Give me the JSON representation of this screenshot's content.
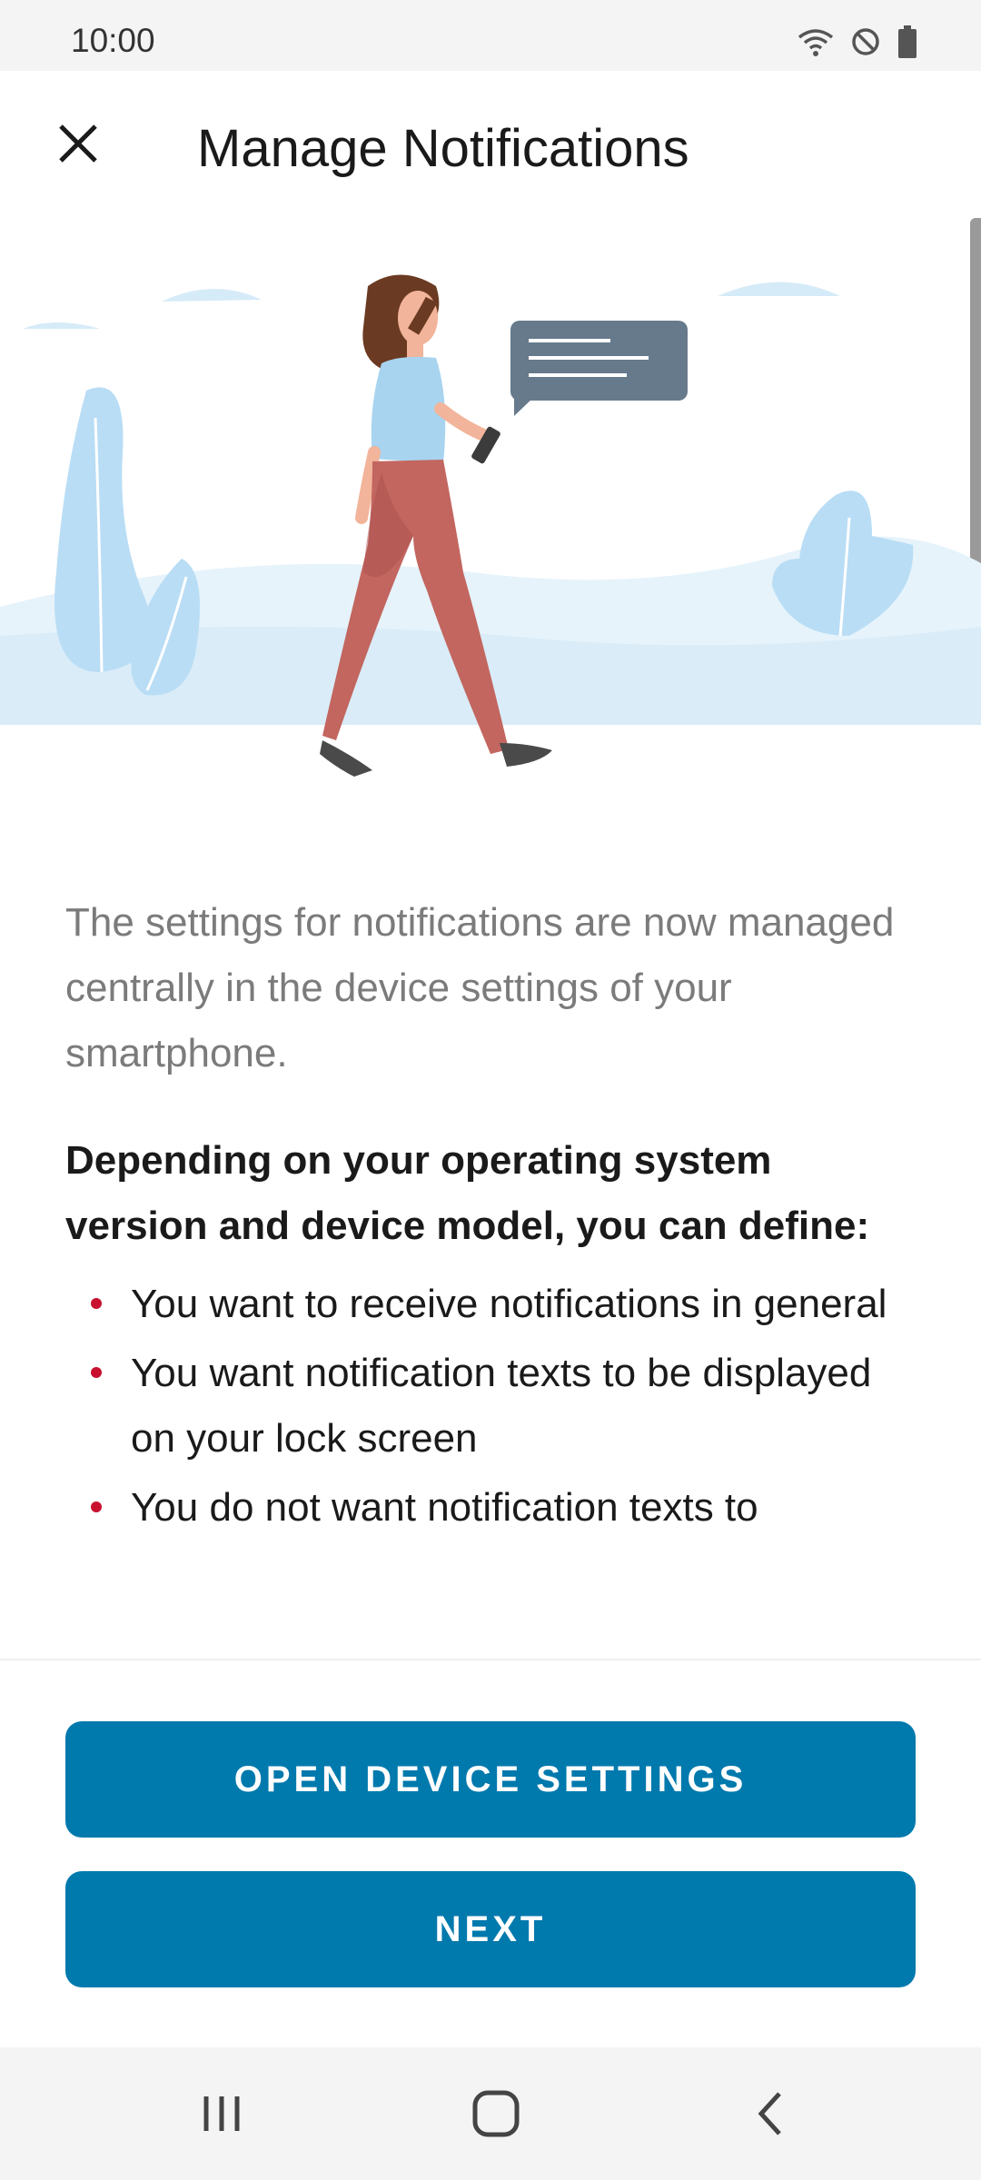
{
  "status_bar": {
    "time": "10:00",
    "icons": [
      "wifi-icon",
      "do-not-disturb-icon",
      "battery-icon"
    ]
  },
  "app_bar": {
    "close_icon": "close-icon",
    "title": "Manage Notifications"
  },
  "illustration": {
    "description_icon": "woman-with-phone-illustration"
  },
  "content": {
    "intro": "The settings for notifications are now managed centrally in the device settings of your smartphone.",
    "subhead": "Depending on your operating system version and device model, you can define:",
    "bullets": [
      "You want to receive notifications in general",
      "You want notification texts to be displayed on your lock screen",
      "You do not want notification texts to"
    ]
  },
  "buttons": {
    "open_device_settings": "OPEN DEVICE SETTINGS",
    "next": "NEXT"
  },
  "nav_bar": {
    "recents_icon": "recents-icon",
    "home_icon": "home-icon",
    "back_icon": "back-icon"
  },
  "colors": {
    "primary": "#0079ad",
    "bullet": "#c8102e",
    "illustration_blue": "#bfe0f7",
    "speech_bubble": "#677a8c",
    "pants": "#c2665f"
  }
}
